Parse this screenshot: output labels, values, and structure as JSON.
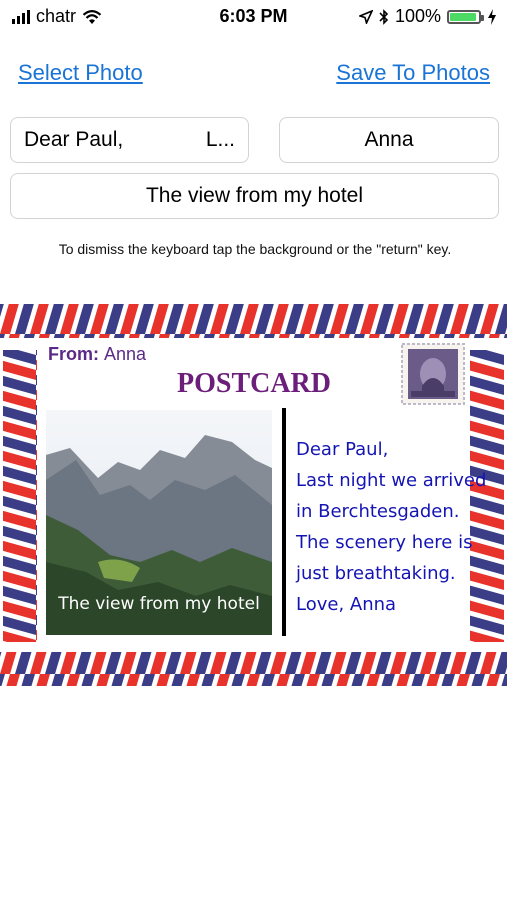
{
  "status_bar": {
    "carrier": "chatr",
    "time": "6:03 PM",
    "battery": "100%"
  },
  "actions": {
    "select_photo": "Select Photo",
    "save_to_photos": "Save To Photos"
  },
  "fields": {
    "greeting_value": "Dear Paul,",
    "greeting_trailing": "L...",
    "from_value": "Anna",
    "caption_value": "The view from my hotel"
  },
  "hint": "To dismiss the keyboard tap the background or the \"return\" key.",
  "postcard": {
    "from_label": "From:",
    "from_name": "Anna",
    "title": "POSTCARD",
    "photo_caption": "The view from my hotel",
    "message_lines": [
      "Dear Paul,",
      "Last night we arrived",
      "in Berchtesgaden.",
      "The scenery here is",
      "just breathtaking.",
      "Love, Anna"
    ]
  },
  "colors": {
    "accent": "#1a74d6",
    "stripe_red": "#e8322c",
    "stripe_blue": "#3b3d87",
    "title_purple": "#6b1f7a",
    "message_blue": "#1414b4"
  }
}
